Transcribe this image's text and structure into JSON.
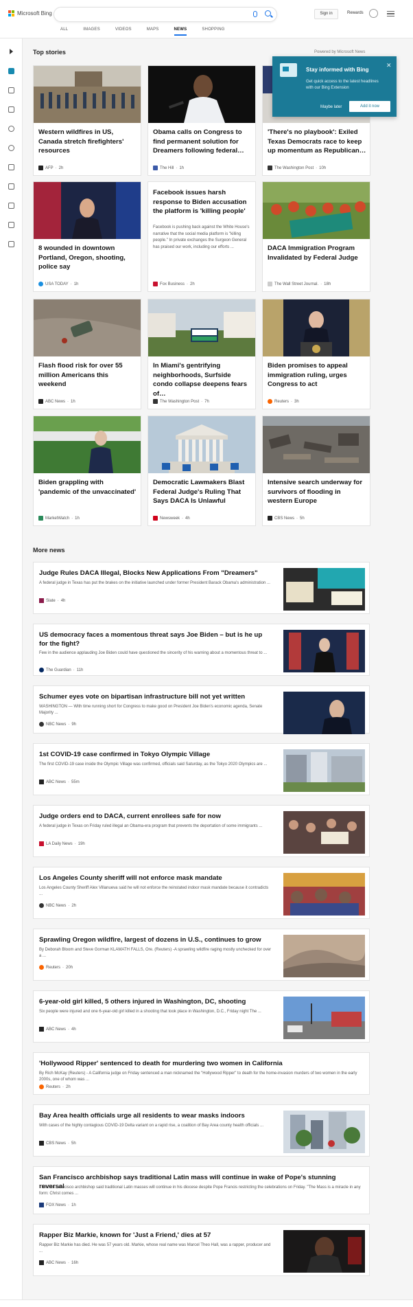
{
  "header": {
    "logo_text": "Microsoft Bing",
    "tabs": [
      "ALL",
      "IMAGES",
      "VIDEOS",
      "MAPS",
      "NEWS",
      "SHOPPING"
    ],
    "active_tab": "NEWS",
    "signin_label": "Sign in",
    "rewards_label": "Rewards"
  },
  "sidebar": {
    "icons": [
      "expand-icon",
      "home-icon",
      "sports-icon",
      "flag-icon",
      "location-icon",
      "globe-icon",
      "science-icon",
      "rocket-icon",
      "entertainment-icon",
      "bank-icon",
      "money-icon"
    ]
  },
  "top_stories": {
    "title": "Top stories",
    "powered_by": "Powered by Microsoft News",
    "cards": [
      {
        "title": "Western wildfires in US, Canada stretch firefighters' resources",
        "source": "AFP",
        "time": "2h"
      },
      {
        "title": "Obama calls on Congress to find permanent solution for Dreamers following federal…",
        "source": "The Hill",
        "time": "1h"
      },
      {
        "title": "'There's no playbook': Exiled Texas Democrats race to keep up momentum as Republican…",
        "source": "The Washington Post",
        "time": "10h"
      },
      {
        "title": "8 wounded in downtown Portland, Oregon, shooting, police say",
        "source": "USA TODAY",
        "time": "1h"
      },
      {
        "title": "Facebook issues harsh response to Biden accusation the platform is 'killing people'",
        "snippet": "Facebook is pushing back against the White House's narrative that the social media platform is \"killing people.\" In private exchanges the Surgeon General has praised our work, including our efforts ...",
        "source": "Fox Business",
        "time": "2h"
      },
      {
        "title": "DACA Immigration Program Invalidated by Federal Judge",
        "source": "The Wall Street Journal.",
        "time": "18h"
      },
      {
        "title": "Flash flood risk for over 55 million Americans this weekend",
        "source": "ABC News",
        "time": "1h"
      },
      {
        "title": "In Miami's gentrifying neighborhoods, Surfside condo collapse deepens fears of…",
        "source": "The Washington Post",
        "time": "7h"
      },
      {
        "title": "Biden promises to appeal immigration ruling, urges Congress to act",
        "source": "Reuters",
        "time": "3h"
      },
      {
        "title": "Biden grappling with 'pandemic of the unvaccinated'",
        "source": "MarketWatch",
        "time": "1h"
      },
      {
        "title": "Democratic Lawmakers Blast Federal Judge's Ruling That Says DACA Is Unlawful",
        "source": "Newsweek",
        "time": "4h"
      },
      {
        "title": "Intensive search underway for survivors of flooding in western Europe",
        "source": "CBS News",
        "time": "5h"
      }
    ]
  },
  "popup": {
    "heading": "Stay informed with Bing",
    "body": "Get quick access to the latest headlines with our Bing Extension",
    "later_label": "Maybe later",
    "add_label": "Add it now"
  },
  "more_news": {
    "title": "More news",
    "items": [
      {
        "title": "Judge Rules DACA Illegal, Blocks New Applications From \"Dreamers\"",
        "snippet": "A federal judge in Texas has put the brakes on the initiative launched under former President Barack Obama's administration ...",
        "source": "Slate",
        "time": "4h"
      },
      {
        "title": "US democracy faces a momentous threat says Joe Biden – but is he up for the fight?",
        "snippet": "Few in the audience applauding Joe Biden could have questioned the sincerity of his warning about a momentous threat to ...",
        "source": "The Guardian",
        "time": "11h"
      },
      {
        "title": "Schumer eyes vote on bipartisan infrastructure bill not yet written",
        "snippet": "WASHINGTON — With time running short for Congress to make good on President Joe Biden's economic agenda, Senate Majority ...",
        "source": "NBC News",
        "time": "9h"
      },
      {
        "title": "1st COVID-19 case confirmed in Tokyo Olympic Village",
        "snippet": "The first COVID-19 case inside the Olympic Village was confirmed, officials said Saturday, as the Tokyo 2020 Olympics are ...",
        "source": "ABC News",
        "time": "55m"
      },
      {
        "title": "Judge orders end to DACA, current enrollees safe for now",
        "snippet": "A federal judge in Texas on Friday ruled illegal an Obama-era program that prevents the deportation of some immigrants ...",
        "source": "LA Daily News",
        "time": "19h"
      },
      {
        "title": "Los Angeles County sheriff will not enforce mask mandate",
        "snippet": "Los Angeles County Sheriff Alex Villanueva said he will not enforce the reinstated indoor mask mandate because it contradicts ...",
        "source": "NBC News",
        "time": "2h"
      },
      {
        "title": "Sprawling Oregon wildfire, largest of dozens in U.S., continues to grow",
        "snippet": "By Deborah Bloom and Steve Gorman KLAMATH FALLS, Ore. (Reuters) -A sprawling wildfire raging mostly unchecked for over a ...",
        "source": "Reuters",
        "time": "20h"
      },
      {
        "title": "6-year-old girl killed, 5 others injured in Washington, DC, shooting",
        "snippet": "Six people were injured and one 6-year-old girl killed in a shooting that took place in Washington, D.C., Friday night The ...",
        "source": "ABC News",
        "time": "4h"
      },
      {
        "title": "'Hollywood Ripper' sentenced to death for murdering two women in California",
        "snippet": "By Rich McKay (Reuters) - A California judge on Friday sentenced a man nicknamed the \"Hollywood Ripper\" to death for the home-invasion murders of two women in the early 2000s, one of whom was ...",
        "source": "Reuters",
        "time": "2h"
      },
      {
        "title": "Bay Area health officials urge all residents to wear masks indoors",
        "snippet": "With cases of the highly contagious COVID-19 Delta variant on a rapid rise, a coalition of Bay Area county health officials ...",
        "source": "CBS News",
        "time": "5h"
      },
      {
        "title": "San Francisco archbishop says traditional Latin mass will continue in wake of Pope's stunning reversal",
        "snippet": "The San Francisco archbishop said traditional Latin masses will continue in his diocese despite Pope Francis restricting the celebrations on Friday. \"The Mass is a miracle in any form: Christ comes ...",
        "source": "FOX News",
        "time": "1h"
      },
      {
        "title": "Rapper Biz Markie, known for 'Just a Friend,' dies at 57",
        "snippet": "Rapper Biz Markie has died. He was 57 years old. Markie, whose real name was Marcel Theo Hall, was a rapper, producer and ...",
        "source": "ABC News",
        "time": "16h"
      }
    ]
  },
  "colors": {
    "accent": "#1a73e8",
    "popup_bg": "#1b7a97",
    "sidebar_active": "#178ab0"
  }
}
